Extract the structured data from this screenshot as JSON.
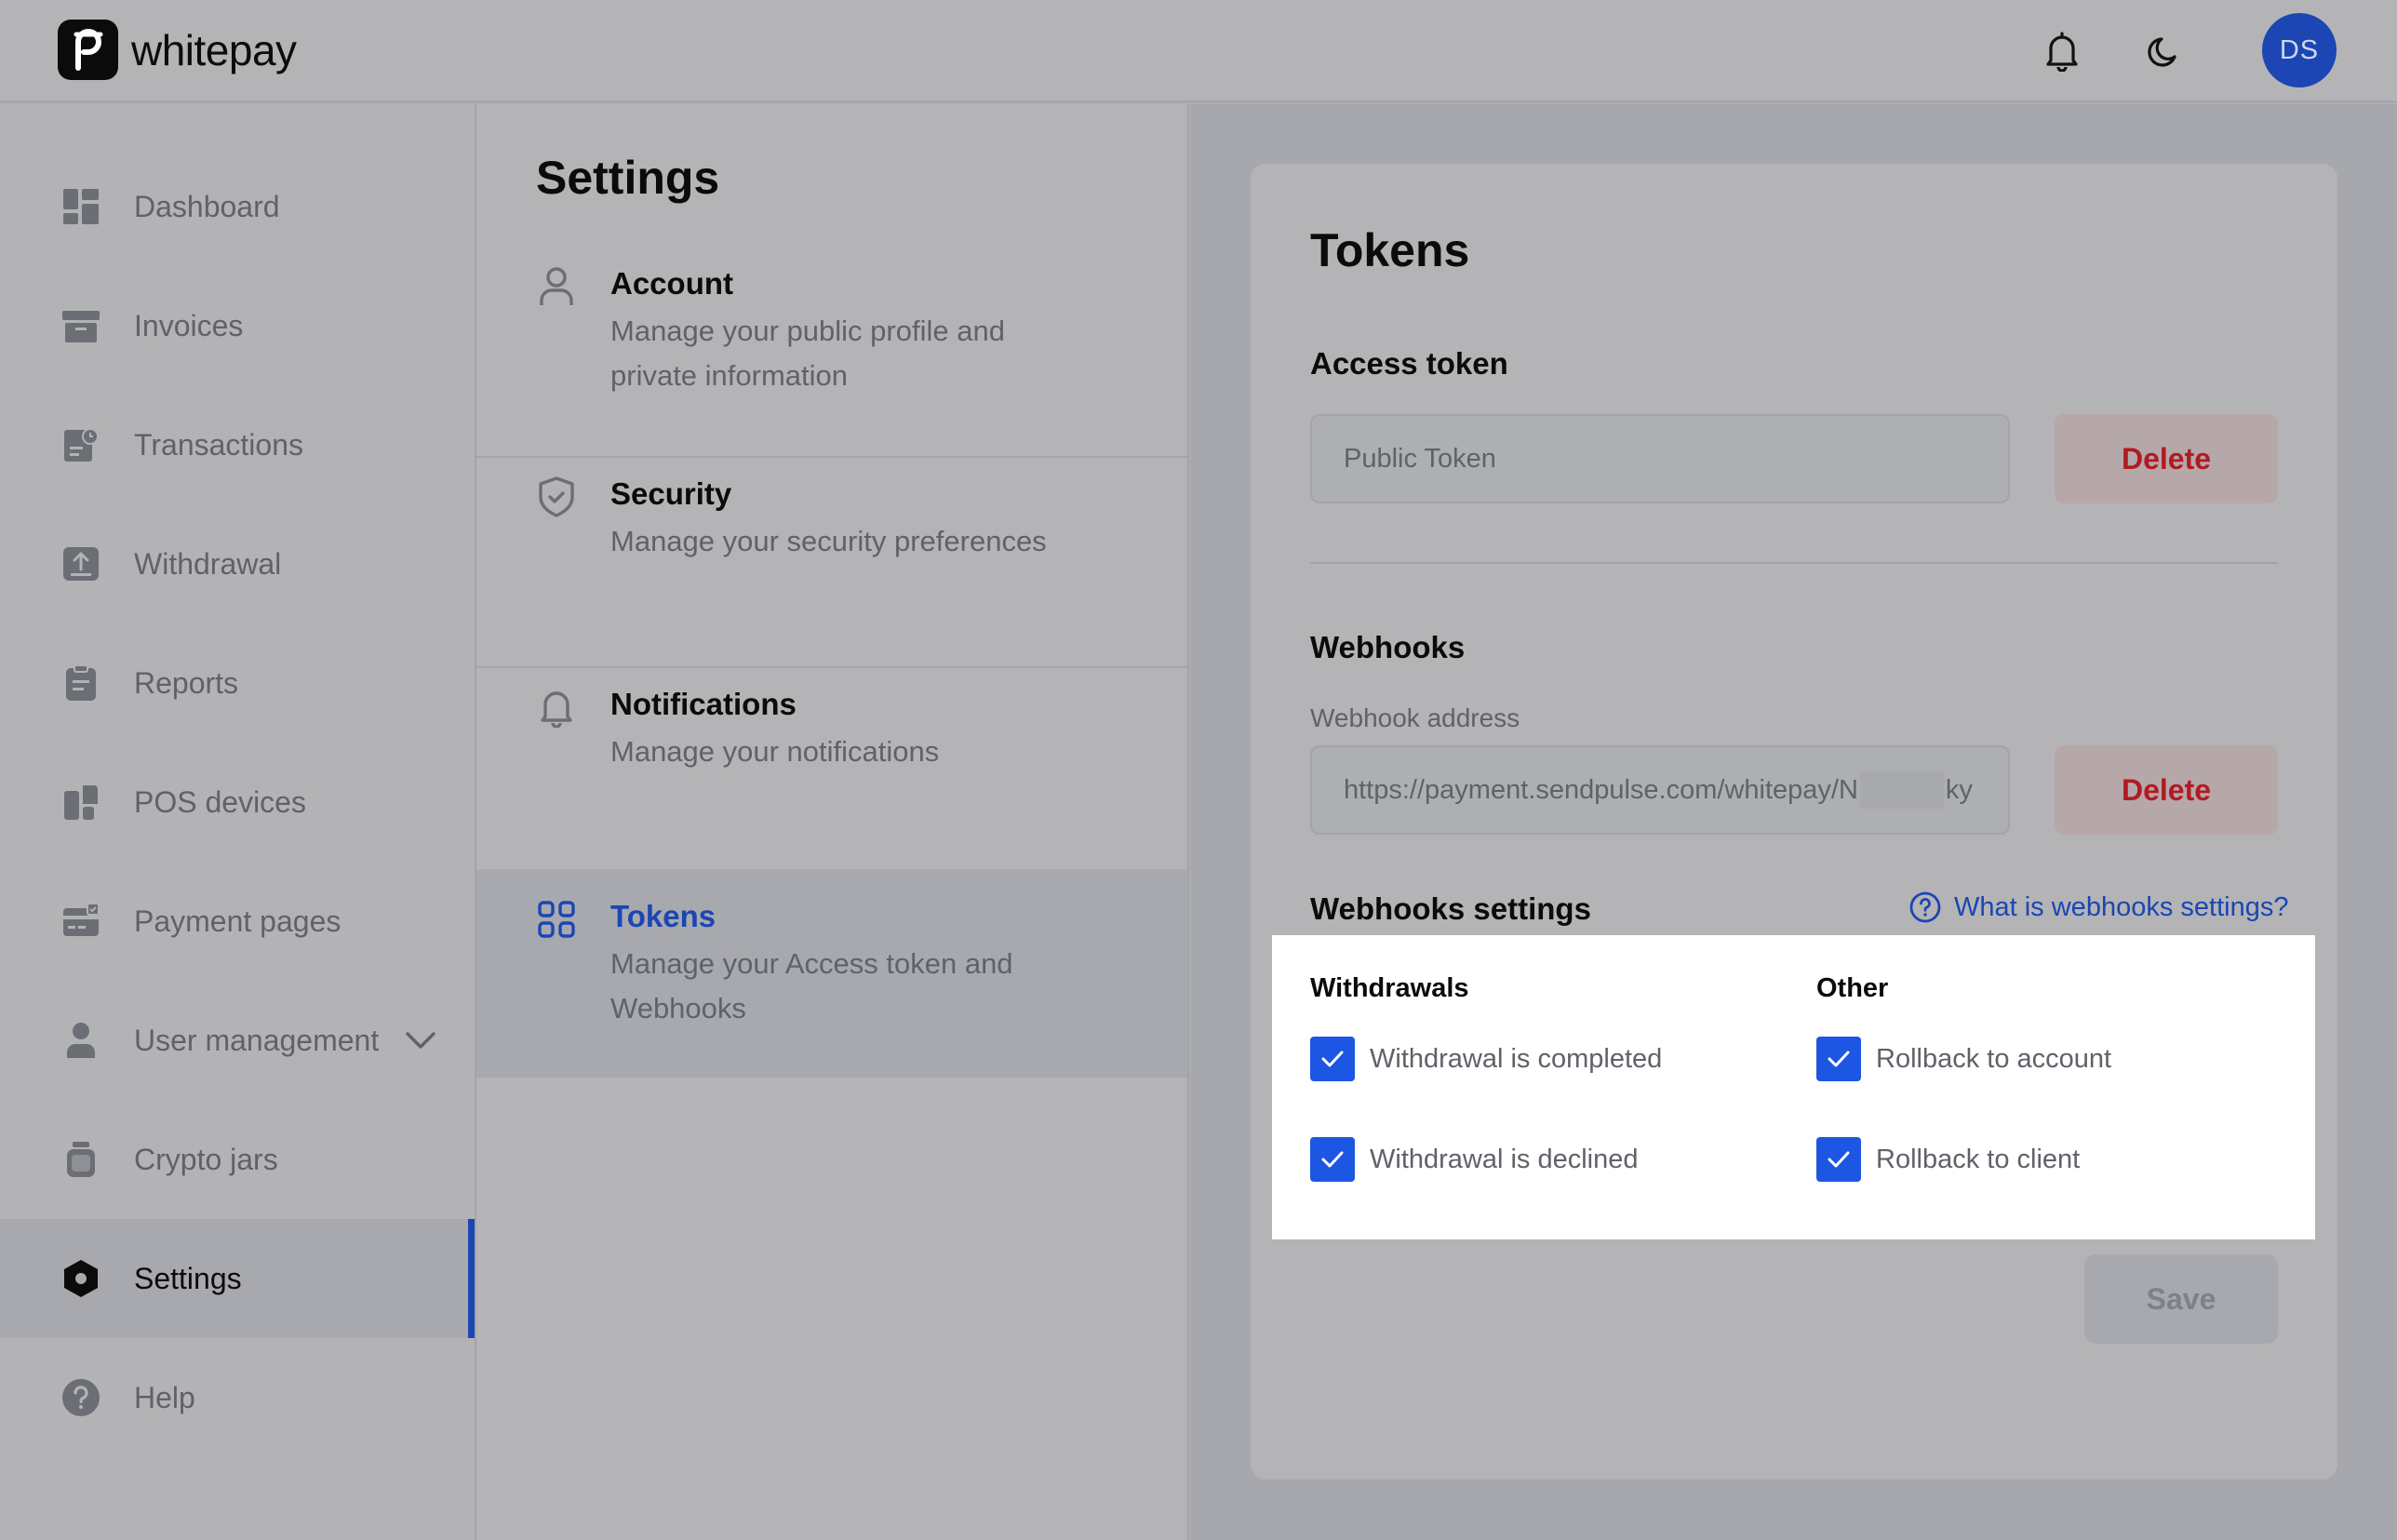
{
  "header": {
    "brand": "whitepay",
    "avatar_initials": "DS",
    "icons": [
      "bell-icon",
      "moon-icon"
    ]
  },
  "sidebar": {
    "items": [
      {
        "label": "Dashboard",
        "icon": "dashboard-icon"
      },
      {
        "label": "Invoices",
        "icon": "invoice-icon"
      },
      {
        "label": "Transactions",
        "icon": "transactions-icon"
      },
      {
        "label": "Withdrawal",
        "icon": "withdrawal-icon"
      },
      {
        "label": "Reports",
        "icon": "reports-icon"
      },
      {
        "label": "POS devices",
        "icon": "pos-icon"
      },
      {
        "label": "Payment pages",
        "icon": "payment-page-icon"
      },
      {
        "label": "User management",
        "icon": "user-icon"
      },
      {
        "label": "Crypto jars",
        "icon": "jar-icon"
      },
      {
        "label": "Settings",
        "icon": "settings-icon",
        "active": true
      },
      {
        "label": "Help",
        "icon": "help-icon"
      }
    ]
  },
  "settings": {
    "title": "Settings",
    "items": [
      {
        "title": "Account",
        "desc": "Manage your public profile and private information",
        "icon": "user-outline-icon"
      },
      {
        "title": "Security",
        "desc": "Manage your security preferences",
        "icon": "shield-icon"
      },
      {
        "title": "Notifications",
        "desc": "Manage your notifications",
        "icon": "bell-outline-icon"
      },
      {
        "title": "Tokens",
        "desc": "Manage your Access token and Webhooks",
        "icon": "grid-icon",
        "active": true
      }
    ]
  },
  "tokens": {
    "title": "Tokens",
    "access_token": {
      "heading": "Access token",
      "placeholder": "Public Token",
      "delete_label": "Delete"
    },
    "webhooks": {
      "heading": "Webhooks",
      "address_label": "Webhook address",
      "address_value_start": "https://payment.sendpulse.com/whitepay/N",
      "address_value_end": "ky",
      "delete_label": "Delete"
    },
    "webhooks_settings": {
      "heading": "Webhooks settings",
      "help_link": "What is webhooks settings?",
      "withdrawals": {
        "heading": "Withdrawals",
        "options": [
          {
            "label": "Withdrawal is completed",
            "checked": true
          },
          {
            "label": "Withdrawal is declined",
            "checked": true
          }
        ]
      },
      "other": {
        "heading": "Other",
        "options": [
          {
            "label": "Rollback to account",
            "checked": true
          },
          {
            "label": "Rollback to client",
            "checked": true
          }
        ]
      }
    },
    "save_label": "Save"
  },
  "colors": {
    "accent": "#1b46b3",
    "checkbox": "#1c56e2",
    "danger": "#b01b22"
  }
}
